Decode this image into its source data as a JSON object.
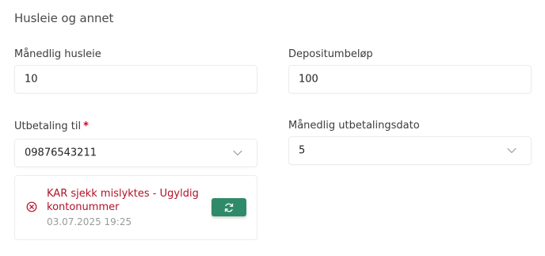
{
  "section": {
    "title": "Husleie og annet"
  },
  "fields": {
    "monthly_rent": {
      "label": "Månedlig husleie",
      "value": "10"
    },
    "deposit": {
      "label": "Depositumbeløp",
      "value": "100"
    },
    "payout_to": {
      "label": "Utbetaling til",
      "required_marker": "*",
      "value": "09876543211"
    },
    "monthly_payout_date": {
      "label": "Månedlig utbetalingsdato",
      "value": "5"
    }
  },
  "status": {
    "message": "KAR sjekk mislyktes - Ugyldig kontonummer",
    "timestamp": "03.07.2025 19:25",
    "icon": "error-circle-x-icon",
    "retry_icon": "refresh-icon"
  },
  "colors": {
    "error": "#b11226",
    "accent_green": "#2f8a6a",
    "required": "#d0021b"
  }
}
